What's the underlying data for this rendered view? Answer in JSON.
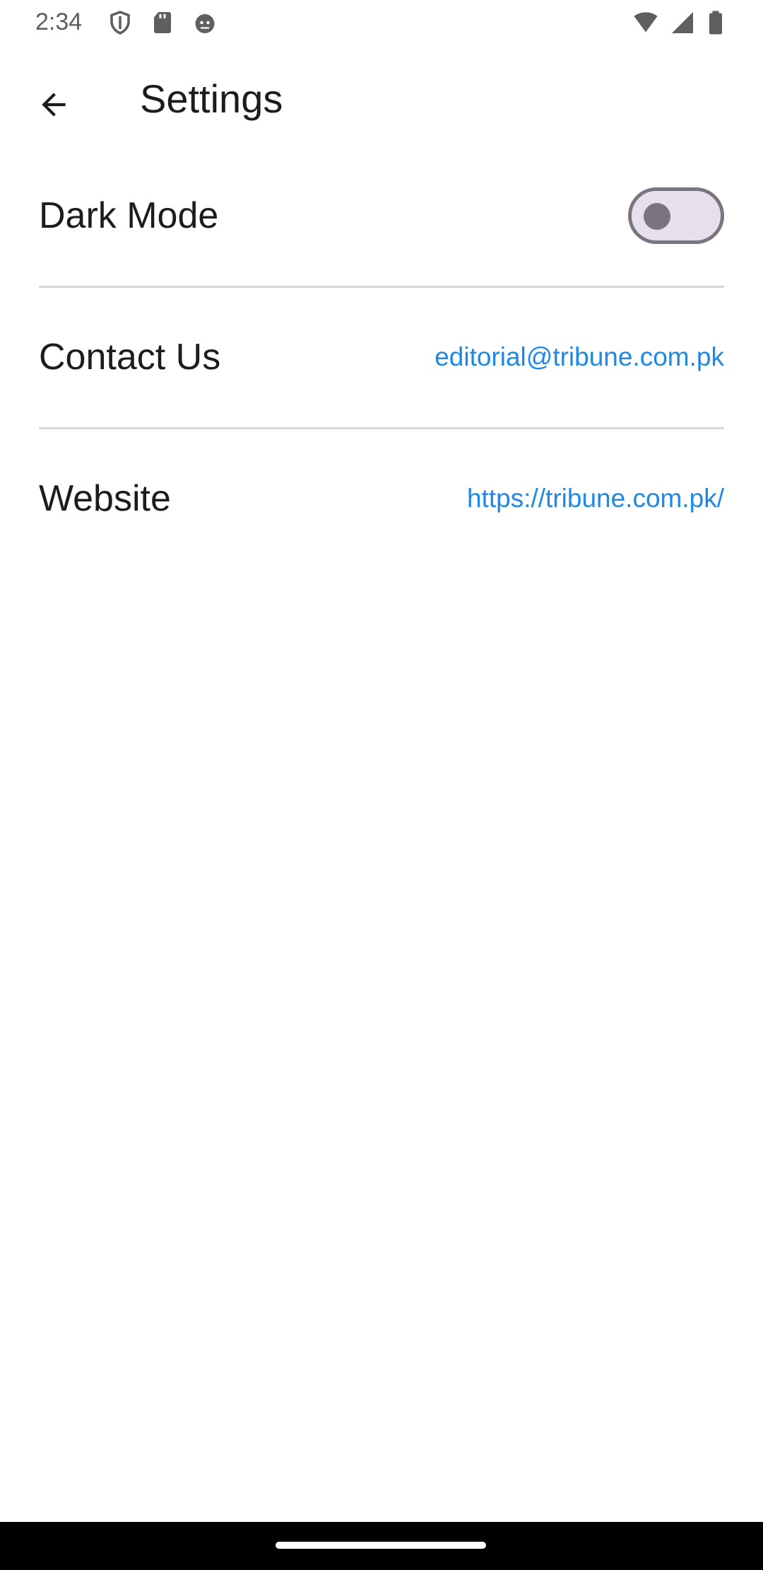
{
  "status_bar": {
    "time": "2:34",
    "left_icons": [
      "shield-icon",
      "sd-card-icon",
      "android-face-icon"
    ],
    "right_icons": [
      "wifi-icon",
      "cell-signal-icon",
      "battery-icon"
    ]
  },
  "app_bar": {
    "title": "Settings",
    "back_icon": "arrow-back-icon"
  },
  "settings": {
    "dark_mode": {
      "label": "Dark Mode",
      "enabled": false
    },
    "contact": {
      "label": "Contact Us",
      "value": "editorial@tribune.com.pk"
    },
    "website": {
      "label": "Website",
      "value": "https://tribune.com.pk/"
    }
  },
  "colors": {
    "link": "#1e88e5",
    "divider": "#d8d4e0",
    "toggle_track": "#e7e0ec",
    "toggle_outline": "#7a7580",
    "text": "#1d1b20"
  }
}
